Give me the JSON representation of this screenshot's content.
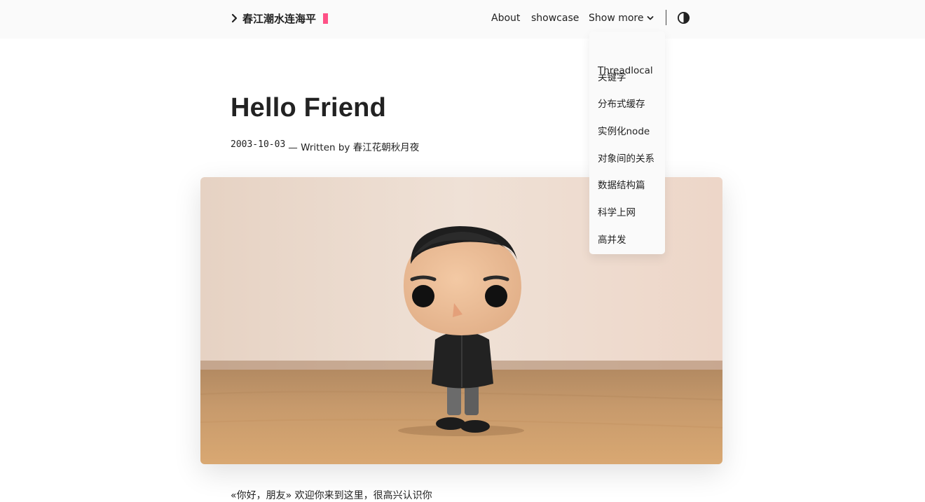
{
  "header": {
    "site_title": "春江潮水连海平",
    "nav": {
      "about": "About",
      "showcase": "showcase",
      "show_more": "Show more"
    }
  },
  "dropdown": {
    "items": [
      "Threadlocal",
      "关键字",
      "分布式缓存",
      "实例化node",
      "对象间的关系",
      "数据结构篇",
      "科学上网",
      "高并发"
    ]
  },
  "post": {
    "title": "Hello Friend",
    "date": "2003-10-03",
    "byline": "— Written by 春江花朝秋月夜",
    "intro": "«你好，朋友» 欢迎你来到这里，很高兴认识你"
  },
  "colors": {
    "accent": "#fe5186",
    "header_bg": "#fafafa",
    "text": "#222222"
  },
  "icons": {
    "logo_prefix": "chevron-right-icon",
    "show_more": "chevron-down-icon",
    "theme_toggle": "contrast-icon"
  }
}
